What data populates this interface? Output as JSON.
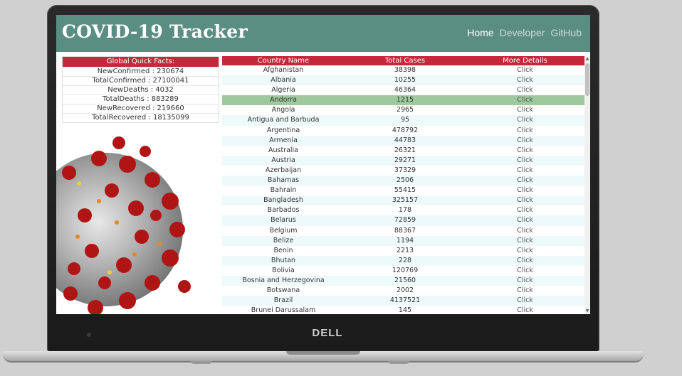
{
  "app": {
    "title": "COVID-19 Tracker",
    "brand": "DELL"
  },
  "nav": [
    {
      "label": "Home",
      "active": true
    },
    {
      "label": "Developer",
      "active": false
    },
    {
      "label": "GitHub",
      "active": false
    }
  ],
  "facts": {
    "header": "Global Quick Facts:",
    "items": [
      "NewConfirmed : 230674",
      "TotalConfirmed : 27100041",
      "NewDeaths : 4032",
      "TotalDeaths : 883289",
      "NewRecovered : 219660",
      "TotalRecovered : 18135099"
    ]
  },
  "table": {
    "headers": [
      "Country Name",
      "Total Cases",
      "More Details"
    ],
    "link_label": "Click",
    "selected_index": 3,
    "rows": [
      [
        "Afghanistan",
        "38398"
      ],
      [
        "Albania",
        "10255"
      ],
      [
        "Algeria",
        "46364"
      ],
      [
        "Andorra",
        "1215"
      ],
      [
        "Angola",
        "2965"
      ],
      [
        "Antigua and Barbuda",
        "95"
      ],
      [
        "Argentina",
        "478792"
      ],
      [
        "Armenia",
        "44783"
      ],
      [
        "Australia",
        "26321"
      ],
      [
        "Austria",
        "29271"
      ],
      [
        "Azerbaijan",
        "37329"
      ],
      [
        "Bahamas",
        "2506"
      ],
      [
        "Bahrain",
        "55415"
      ],
      [
        "Bangladesh",
        "325157"
      ],
      [
        "Barbados",
        "178"
      ],
      [
        "Belarus",
        "72859"
      ],
      [
        "Belgium",
        "88367"
      ],
      [
        "Belize",
        "1194"
      ],
      [
        "Benin",
        "2213"
      ],
      [
        "Bhutan",
        "228"
      ],
      [
        "Bolivia",
        "120769"
      ],
      [
        "Bosnia and Herzegovina",
        "21560"
      ],
      [
        "Botswana",
        "2002"
      ],
      [
        "Brazil",
        "4137521"
      ],
      [
        "Brunei Darussalam",
        "145"
      ]
    ]
  },
  "colors": {
    "header_bar": "#5b8e83",
    "accent_red": "#c6283b",
    "row_alt": "#eefafa",
    "row_selected": "#9ec99e"
  },
  "icons": {
    "virus": "coronavirus-illustration"
  }
}
